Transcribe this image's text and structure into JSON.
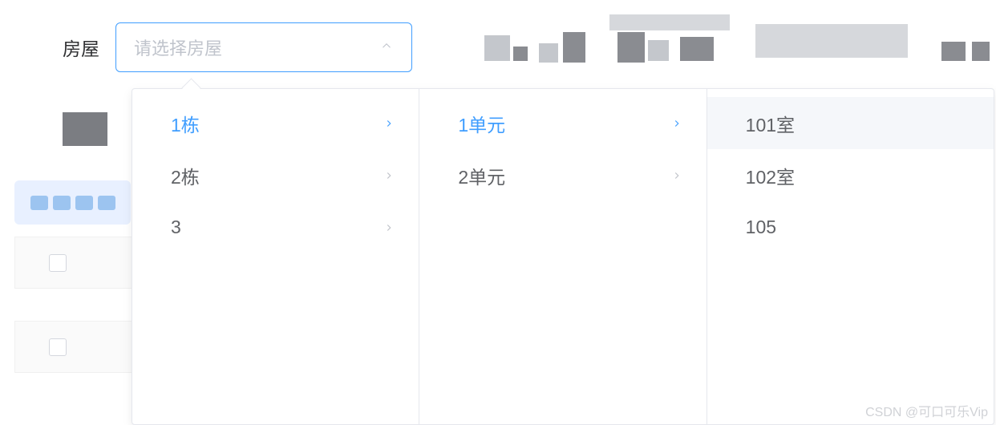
{
  "field": {
    "label": "房屋",
    "placeholder": "请选择房屋"
  },
  "cascader": {
    "cols": [
      {
        "items": [
          {
            "label": "1栋",
            "active": true,
            "has_children": true
          },
          {
            "label": "2栋",
            "active": false,
            "has_children": true
          },
          {
            "label": "3",
            "active": false,
            "has_children": true
          }
        ]
      },
      {
        "items": [
          {
            "label": "1单元",
            "active": true,
            "has_children": true
          },
          {
            "label": "2单元",
            "active": false,
            "has_children": true
          }
        ]
      },
      {
        "items": [
          {
            "label": "101室",
            "active": false,
            "has_children": false,
            "hover": true
          },
          {
            "label": "102室",
            "active": false,
            "has_children": false
          },
          {
            "label": "105",
            "active": false,
            "has_children": false
          }
        ]
      }
    ]
  },
  "watermark": "CSDN @可口可乐Vip"
}
